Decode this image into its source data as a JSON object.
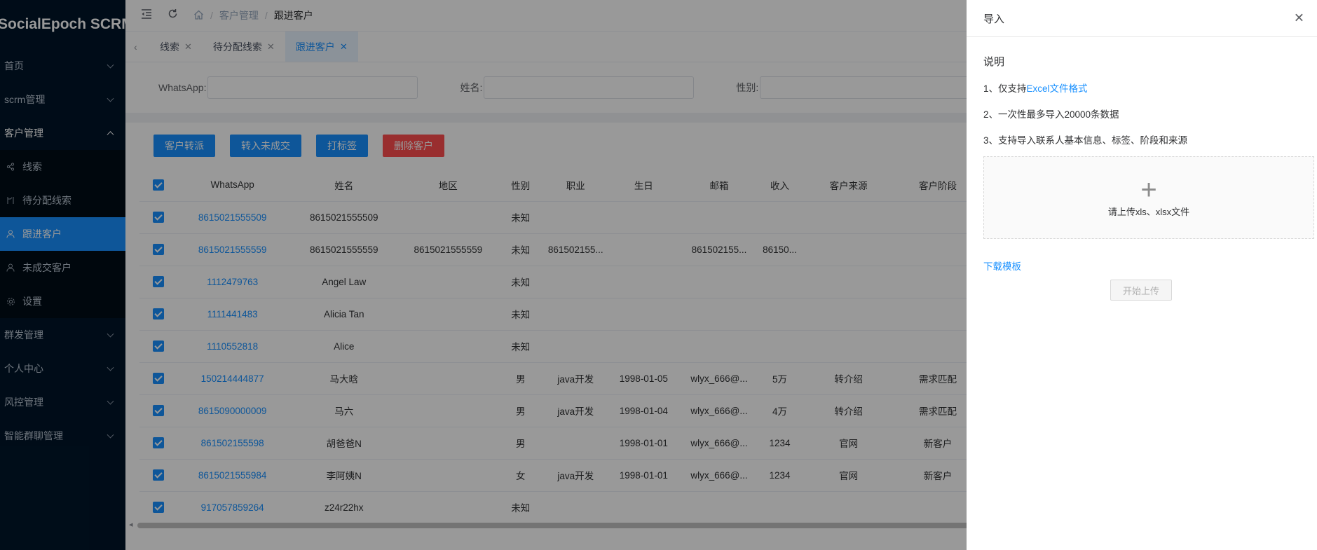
{
  "app": {
    "title": "SocialEpoch SCRM"
  },
  "sidebar": {
    "menus": [
      {
        "label": "首页"
      },
      {
        "label": "scrm管理"
      },
      {
        "label": "客户管理"
      },
      {
        "label": "群发管理"
      },
      {
        "label": "个人中心"
      },
      {
        "label": "风控管理"
      },
      {
        "label": "智能群聊管理"
      }
    ],
    "sub_items": [
      {
        "label": "线索",
        "icon": "share-icon"
      },
      {
        "label": "待分配线索",
        "icon": "merge-icon"
      },
      {
        "label": "跟进客户",
        "icon": "user-icon"
      },
      {
        "label": "未成交客户",
        "icon": "user-icon"
      },
      {
        "label": "设置",
        "icon": "gear-icon"
      }
    ]
  },
  "breadcrumb": {
    "home": "home-icon",
    "parent": "客户管理",
    "current": "跟进客户"
  },
  "tabs": [
    {
      "label": "线索"
    },
    {
      "label": "待分配线索"
    },
    {
      "label": "跟进客户"
    }
  ],
  "filters": [
    {
      "label": "WhatsApp:"
    },
    {
      "label": "姓名:"
    },
    {
      "label": "性别:"
    }
  ],
  "actions": {
    "transfer": "客户转派",
    "to_unclosed": "转入未成交",
    "tag": "打标签",
    "delete": "删除客户"
  },
  "table": {
    "columns": [
      "WhatsApp",
      "姓名",
      "地区",
      "性别",
      "职业",
      "生日",
      "邮箱",
      "收入",
      "客户来源",
      "客户阶段"
    ],
    "rows": [
      [
        "8615021555509",
        "8615021555509",
        "",
        "未知",
        "",
        "",
        "",
        "",
        "",
        ""
      ],
      [
        "8615021555559",
        "8615021555559",
        "8615021555559",
        "未知",
        "861502155...",
        "",
        "861502155...",
        "86150...",
        "",
        ""
      ],
      [
        "1112479763",
        "Angel Law",
        "",
        "未知",
        "",
        "",
        "",
        "",
        "",
        ""
      ],
      [
        "1111441483",
        "Alicia Tan",
        "",
        "未知",
        "",
        "",
        "",
        "",
        "",
        ""
      ],
      [
        "1110552818",
        "Alice",
        "",
        "未知",
        "",
        "",
        "",
        "",
        "",
        ""
      ],
      [
        "150214444877",
        "马大晗",
        "",
        "男",
        "java开发",
        "1998-01-05",
        "wlyx_666@...",
        "5万",
        "转介绍",
        "需求匹配"
      ],
      [
        "8615090000009",
        "马六",
        "",
        "男",
        "java开发",
        "1998-01-04",
        "wlyx_666@...",
        "4万",
        "转介绍",
        "需求匹配"
      ],
      [
        "861502155598",
        "胡爸爸N",
        "",
        "男",
        "",
        "1998-01-01",
        "wlyx_666@...",
        "1234",
        "官网",
        "新客户"
      ],
      [
        "8615021555984",
        "李阿姨N",
        "",
        "女",
        "java开发",
        "1998-01-01",
        "wlyx_666@...",
        "1234",
        "官网",
        "新客户"
      ],
      [
        "917057859264",
        "z24r22hx",
        "",
        "未知",
        "",
        "",
        "",
        "",
        "",
        ""
      ]
    ]
  },
  "drawer": {
    "title": "导入",
    "heading": "说明",
    "line1_prefix": "1、仅支持",
    "line1_highlight": "Excel文件格式",
    "line2": "2、一次性最多导入20000条数据",
    "line3": "3、支持导入联系人基本信息、标签、阶段和来源",
    "dropzone_text": "请上传xls、xlsx文件",
    "download_template": "下载模板",
    "start_upload": "开始上传"
  },
  "colors": {
    "primary": "#1890ff",
    "danger": "#ff4d4f",
    "sidebar": "#001529"
  }
}
